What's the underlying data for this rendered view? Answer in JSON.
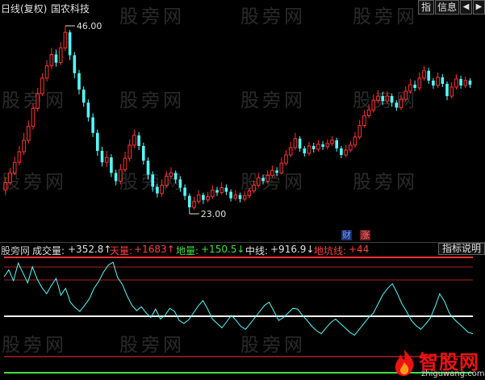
{
  "header": {
    "title": "日线(复权)",
    "stock_name": "国农科技",
    "btn_zhi": "指",
    "btn_info": "信息",
    "btn_left": "◀",
    "btn_right": "▶"
  },
  "price_chart": {
    "high_label": "46.00",
    "low_label": "23.00",
    "up_color": "#ff3232",
    "down_color": "#54fcfc"
  },
  "markers": {
    "cai": "财",
    "zhang": "涨"
  },
  "indicator": {
    "name": "股旁网",
    "cjl_label": "成交量:",
    "cjl_value": "+352.8↑",
    "tl_label": "天量:",
    "tl_value": "+1683↑",
    "dl_label": "地量:",
    "dl_value": "+150.5↓",
    "zx_label": "中线:",
    "zx_value": "+916.9↓",
    "dkx_label": "地坑线:",
    "dkx_value": "+44",
    "explain_button": "指标说明"
  },
  "watermark": "股旁网",
  "logo": {
    "text": "智股网",
    "url": "zhiguwang.com"
  },
  "chart_data": {
    "type": "candlestick",
    "price_max": 46.0,
    "price_min": 23.0,
    "candles": [
      [
        25.9,
        26.8,
        25.3,
        27.5
      ],
      [
        26.8,
        28.0,
        26.5,
        28.6
      ],
      [
        28.0,
        29.3,
        27.7,
        30.0
      ],
      [
        29.3,
        30.6,
        28.9,
        31.3
      ],
      [
        30.6,
        32.0,
        30.2,
        32.9
      ],
      [
        32.0,
        33.7,
        31.6,
        34.4
      ],
      [
        33.7,
        35.9,
        33.3,
        36.5
      ],
      [
        35.9,
        37.7,
        35.5,
        38.4
      ],
      [
        37.7,
        39.6,
        37.4,
        40.2
      ],
      [
        39.6,
        41.1,
        39.2,
        41.8
      ],
      [
        41.1,
        42.5,
        40.7,
        43.3
      ],
      [
        42.5,
        41.5,
        41.0,
        43.1
      ],
      [
        41.5,
        43.3,
        41.2,
        44.0
      ],
      [
        43.3,
        45.2,
        42.9,
        46.0
      ],
      [
        45.2,
        42.4,
        41.8,
        45.5
      ],
      [
        42.4,
        40.2,
        39.6,
        42.8
      ],
      [
        40.2,
        38.2,
        37.6,
        40.6
      ],
      [
        38.2,
        36.6,
        36.1,
        38.6
      ],
      [
        36.6,
        34.8,
        34.3,
        37.0
      ],
      [
        34.8,
        32.9,
        32.4,
        35.3
      ],
      [
        32.9,
        30.7,
        30.1,
        33.3
      ],
      [
        30.7,
        29.3,
        28.8,
        31.2
      ],
      [
        29.3,
        29.9,
        28.7,
        30.7
      ],
      [
        29.9,
        28.0,
        27.5,
        30.3
      ],
      [
        28.0,
        27.0,
        26.5,
        28.4
      ],
      [
        27.0,
        28.4,
        26.6,
        29.1
      ],
      [
        28.4,
        29.8,
        28.1,
        30.6
      ],
      [
        29.8,
        31.4,
        29.4,
        32.1
      ],
      [
        31.4,
        32.6,
        31.0,
        33.3
      ],
      [
        32.6,
        31.3,
        30.8,
        33.0
      ],
      [
        31.3,
        29.5,
        29.0,
        31.7
      ],
      [
        29.5,
        27.8,
        27.2,
        29.9
      ],
      [
        27.8,
        26.3,
        25.7,
        28.2
      ],
      [
        26.3,
        25.5,
        25.0,
        26.7
      ],
      [
        25.5,
        26.5,
        25.1,
        27.2
      ],
      [
        26.5,
        27.6,
        26.2,
        28.2
      ],
      [
        27.6,
        28.0,
        27.3,
        28.7
      ],
      [
        28.0,
        27.2,
        26.7,
        28.3
      ],
      [
        27.2,
        26.2,
        25.7,
        27.6
      ],
      [
        26.2,
        25.2,
        24.7,
        26.6
      ],
      [
        25.2,
        23.8,
        23.0,
        25.5
      ],
      [
        23.8,
        24.5,
        23.5,
        25.1
      ],
      [
        24.5,
        25.3,
        24.2,
        25.9
      ],
      [
        25.3,
        24.7,
        24.2,
        25.6
      ],
      [
        24.7,
        25.1,
        24.4,
        25.7
      ],
      [
        25.1,
        25.9,
        24.8,
        26.5
      ],
      [
        25.9,
        25.6,
        25.2,
        26.3
      ],
      [
        25.6,
        26.2,
        25.3,
        26.8
      ],
      [
        26.2,
        25.7,
        25.3,
        26.6
      ],
      [
        25.7,
        24.9,
        24.5,
        26.0
      ],
      [
        24.9,
        25.3,
        24.6,
        25.9
      ],
      [
        25.3,
        24.8,
        24.4,
        25.6
      ],
      [
        24.8,
        25.2,
        24.5,
        25.8
      ],
      [
        25.2,
        25.8,
        24.9,
        26.2
      ],
      [
        25.8,
        26.5,
        25.5,
        27.1
      ],
      [
        26.5,
        27.4,
        26.2,
        28.0
      ],
      [
        27.4,
        27.0,
        26.6,
        27.8
      ],
      [
        27.0,
        27.7,
        26.7,
        28.3
      ],
      [
        27.7,
        28.3,
        27.4,
        28.9
      ],
      [
        28.3,
        28.0,
        27.6,
        28.7
      ],
      [
        28.0,
        29.2,
        27.8,
        29.9
      ],
      [
        29.2,
        30.2,
        28.9,
        30.8
      ],
      [
        30.2,
        31.1,
        29.9,
        31.8
      ],
      [
        31.1,
        32.2,
        30.8,
        32.9
      ],
      [
        32.2,
        31.0,
        30.6,
        32.5
      ],
      [
        31.0,
        30.4,
        30.0,
        31.3
      ],
      [
        30.4,
        31.3,
        30.1,
        31.8
      ],
      [
        31.3,
        30.9,
        30.5,
        31.7
      ],
      [
        30.9,
        31.5,
        30.6,
        32.0
      ],
      [
        31.5,
        31.2,
        30.8,
        31.9
      ],
      [
        31.2,
        31.6,
        30.9,
        32.1
      ],
      [
        31.6,
        32.0,
        31.3,
        32.5
      ],
      [
        32.0,
        31.0,
        30.6,
        32.3
      ],
      [
        31.0,
        30.2,
        29.8,
        31.3
      ],
      [
        30.2,
        30.8,
        29.9,
        31.4
      ],
      [
        30.8,
        31.4,
        30.5,
        31.9
      ],
      [
        31.4,
        32.4,
        31.1,
        33.0
      ],
      [
        32.4,
        33.8,
        32.1,
        34.5
      ],
      [
        33.8,
        35.0,
        33.5,
        35.7
      ],
      [
        35.0,
        35.7,
        34.7,
        36.4
      ],
      [
        35.7,
        36.9,
        35.4,
        37.6
      ],
      [
        36.9,
        37.4,
        36.5,
        38.1
      ],
      [
        37.4,
        36.8,
        36.3,
        37.9
      ],
      [
        36.8,
        37.4,
        36.5,
        38.0
      ],
      [
        37.4,
        36.6,
        36.1,
        37.7
      ],
      [
        36.6,
        36.0,
        35.6,
        36.9
      ],
      [
        36.0,
        37.0,
        35.7,
        37.6
      ],
      [
        37.0,
        38.0,
        36.7,
        38.6
      ],
      [
        38.0,
        38.8,
        37.7,
        39.5
      ],
      [
        38.8,
        38.4,
        38.0,
        39.3
      ],
      [
        38.4,
        39.6,
        38.1,
        40.3
      ],
      [
        39.6,
        40.5,
        39.3,
        41.1
      ],
      [
        40.5,
        39.3,
        38.9,
        40.9
      ],
      [
        39.3,
        38.7,
        38.3,
        39.6
      ],
      [
        38.7,
        39.7,
        38.4,
        40.3
      ],
      [
        39.7,
        38.9,
        38.5,
        40.1
      ],
      [
        38.9,
        37.4,
        36.9,
        39.2
      ],
      [
        37.4,
        38.5,
        37.1,
        39.1
      ],
      [
        38.5,
        39.5,
        38.2,
        40.1
      ],
      [
        39.5,
        38.7,
        38.3,
        39.9
      ],
      [
        38.7,
        39.3,
        38.4,
        39.8
      ],
      [
        39.3,
        38.8,
        38.4,
        39.6
      ]
    ],
    "indicator_lines": {
      "tianliang": 1683,
      "zhongxian": 916.9,
      "diliang": 150.5,
      "dikengxian": 44
    },
    "volume_line": [
      1430,
      1520,
      1380,
      1610,
      1480,
      1350,
      1560,
      1400,
      1290,
      1210,
      1320,
      1410,
      1190,
      1280,
      1100,
      1030,
      980,
      1060,
      1140,
      1280,
      1370,
      1490,
      1580,
      1620,
      1420,
      1330,
      1180,
      1060,
      990,
      1040,
      960,
      900,
      1010,
      880,
      930,
      1020,
      980,
      860,
      820,
      870,
      960,
      1050,
      1120,
      1010,
      880,
      820,
      760,
      840,
      930,
      860,
      780,
      740,
      820,
      900,
      980,
      1060,
      1100,
      980,
      860,
      900,
      960,
      1020,
      1010,
      930,
      860,
      780,
      720,
      680,
      760,
      830,
      880,
      820,
      760,
      700,
      660,
      740,
      820,
      900,
      960,
      1080,
      1200,
      1280,
      1340,
      1220,
      1080,
      980,
      860,
      790,
      740,
      810,
      890,
      1040,
      1210,
      1110,
      960,
      880,
      820,
      760,
      700,
      680
    ]
  }
}
